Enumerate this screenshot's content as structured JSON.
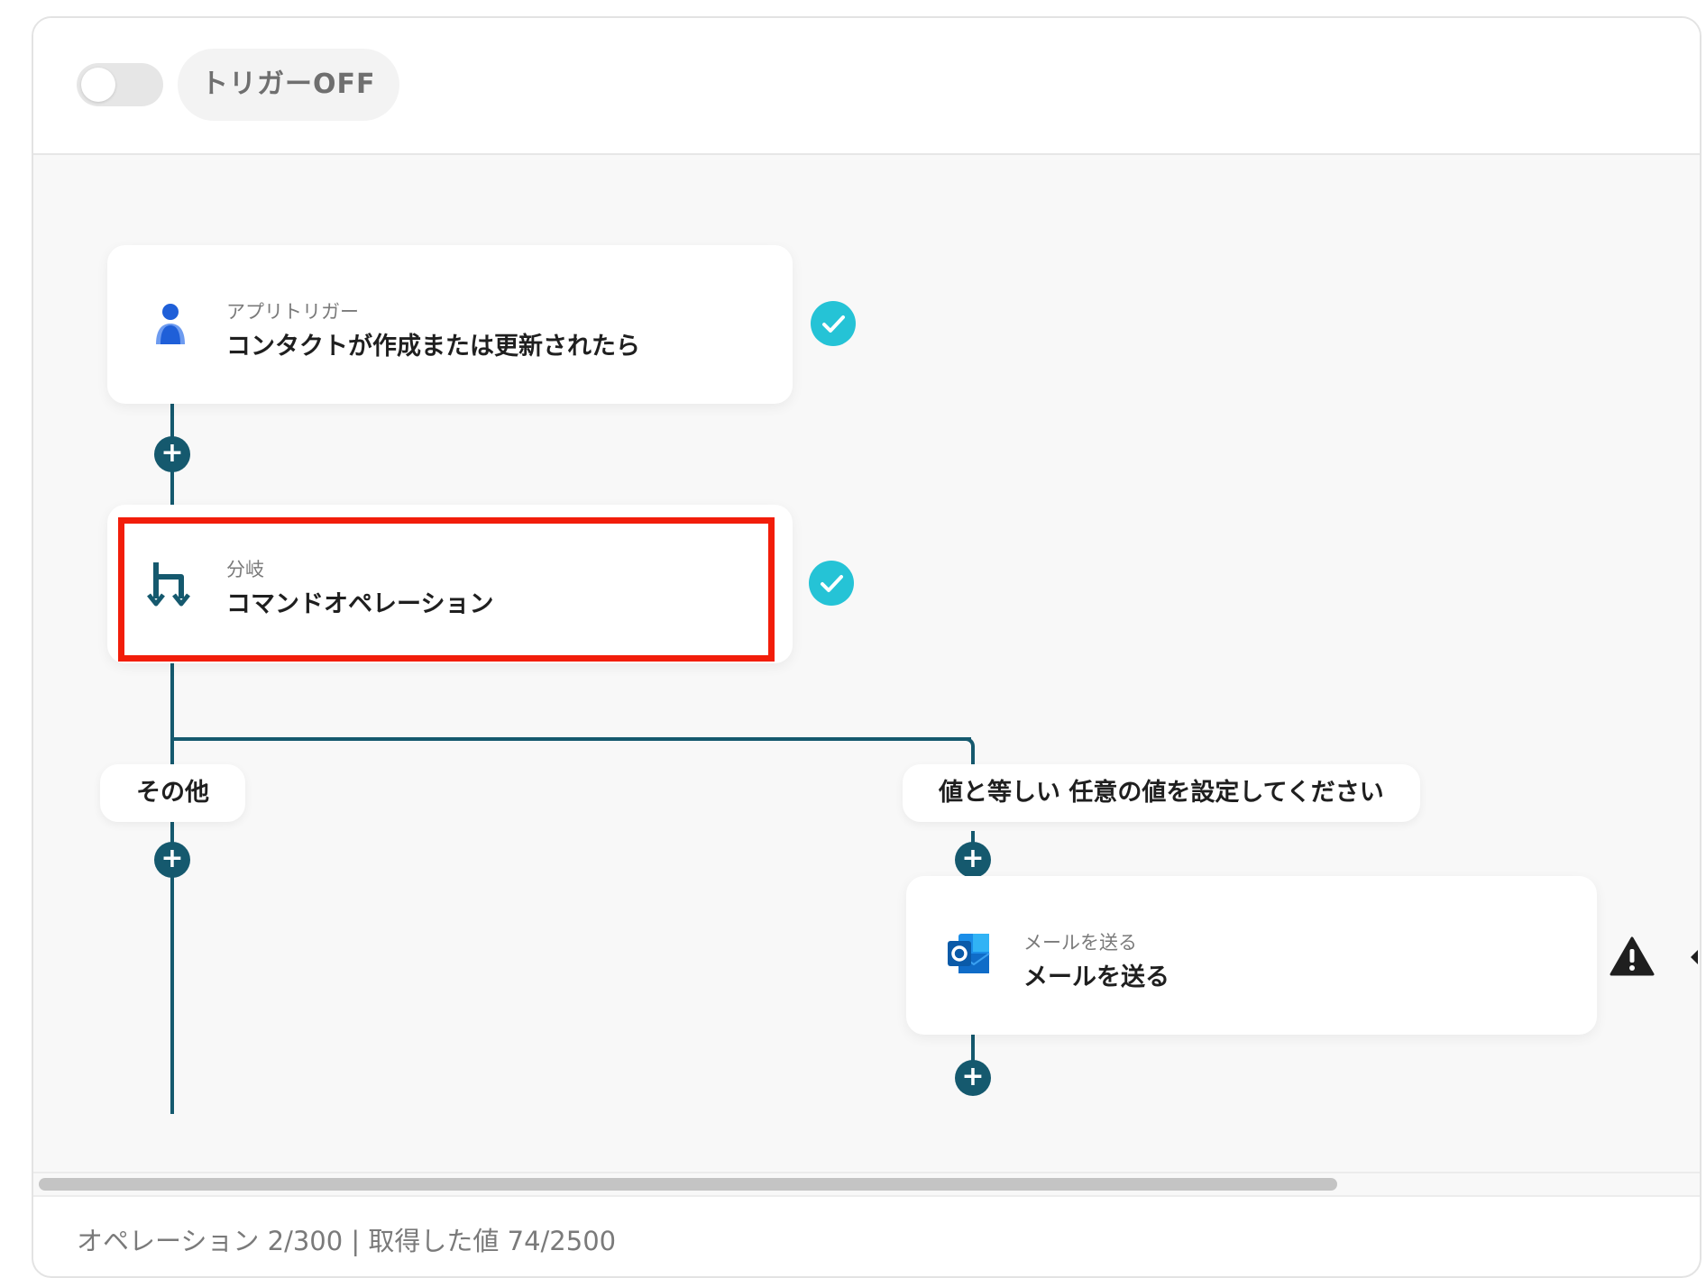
{
  "trigger": {
    "toggle_state": "off",
    "label": "トリガーOFF"
  },
  "flow": {
    "trigger_card": {
      "type": "アプリトリガー",
      "title": "コンタクトが作成または更新されたら",
      "icon": "person-icon",
      "status": "complete"
    },
    "branch_card": {
      "type": "分岐",
      "title": "コマンドオペレーション",
      "icon": "branch-icon",
      "status": "complete",
      "highlighted": true
    },
    "branches": [
      {
        "label": "その他"
      },
      {
        "label": "値と等しい 任意の値を設定してください"
      }
    ],
    "mail_card": {
      "type": "メールを送る",
      "title": "メールを送る",
      "icon": "outlook-icon",
      "status": "warning"
    }
  },
  "footer": {
    "text": "オペレーション 2/300 | 取得した値 74/2500"
  },
  "colors": {
    "connector": "#15596e",
    "check": "#25c3d6",
    "highlight": "#f21d0a"
  }
}
